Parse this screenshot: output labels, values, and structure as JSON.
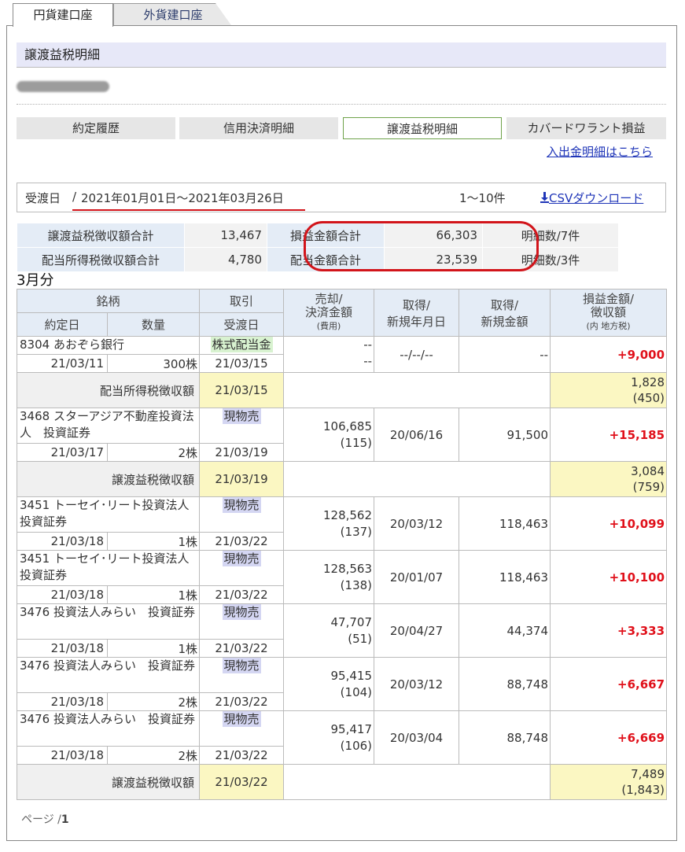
{
  "tabs": {
    "active": "円貨建口座",
    "inactive": "外貨建口座"
  },
  "title": "譲渡益税明細",
  "subtabs": [
    "約定履歴",
    "信用決済明細",
    "譲渡益税明細",
    "カバードワラント損益"
  ],
  "deposit_link": "入出金明細はこちら",
  "date_label": "受渡日",
  "date_slash": "/",
  "date_range": "2021年01月01日～2021年03月26日",
  "count": "1～10件",
  "csv_label": "CSVダウンロード",
  "summary": {
    "row1": {
      "l1": "譲渡益税徴収額合計",
      "v1": "13,467",
      "l2": "損益金額合計",
      "v2": "66,303",
      "n": "明細数/7件"
    },
    "row2": {
      "l1": "配当所得税徴収額合計",
      "v1": "4,780",
      "l2": "配当金額合計",
      "v2": "23,539",
      "n": "明細数/3件"
    }
  },
  "month": "3月分",
  "headers": {
    "brand": "銘柄",
    "trade": "取引",
    "contract_date": "約定日",
    "qty": "数量",
    "delivery": "受渡日",
    "sale1": "売却/",
    "sale2": "決済金額",
    "sale3": "(費用)",
    "acq1": "取得/",
    "acq2": "新規年月日",
    "acqamt1": "取得/",
    "acqamt2": "新規金額",
    "pl1": "損益金額/",
    "pl2": "徴収額",
    "pl3": "(内 地方税)"
  },
  "rows": [
    {
      "name": "8304 あおぞら銀行",
      "trade": "株式配当金",
      "trade_type": "div",
      "date": "21/03/11",
      "qty": "300株",
      "deliv": "21/03/15",
      "sale": "--",
      "cost": "--",
      "acq_date": "--/--/--",
      "acq_amt": "--",
      "pl": "+9,000"
    },
    {
      "tax": true,
      "label": "配当所得税徴収額",
      "deliv": "21/03/15",
      "amt": "1,828",
      "local": "(450)"
    },
    {
      "name": "3468 スターアジア不動産投資法人　投資証券",
      "trade": "現物売",
      "trade_type": "sell",
      "date": "21/03/17",
      "qty": "2株",
      "deliv": "21/03/19",
      "sale": "106,685",
      "cost": "(115)",
      "acq_date": "20/06/16",
      "acq_amt": "91,500",
      "pl": "+15,185"
    },
    {
      "tax": true,
      "label": "譲渡益税徴収額",
      "deliv": "21/03/19",
      "amt": "3,084",
      "local": "(759)"
    },
    {
      "name": "3451 トーセイ･リート投資法人　投資証券",
      "trade": "現物売",
      "trade_type": "sell",
      "date": "21/03/18",
      "qty": "1株",
      "deliv": "21/03/22",
      "sale": "128,562",
      "cost": "(137)",
      "acq_date": "20/03/12",
      "acq_amt": "118,463",
      "pl": "+10,099"
    },
    {
      "name": "3451 トーセイ･リート投資法人　投資証券",
      "trade": "現物売",
      "trade_type": "sell",
      "date": "21/03/18",
      "qty": "1株",
      "deliv": "21/03/22",
      "sale": "128,563",
      "cost": "(138)",
      "acq_date": "20/01/07",
      "acq_amt": "118,463",
      "pl": "+10,100"
    },
    {
      "name": "3476 投資法人みらい　投資証券",
      "trade": "現物売",
      "trade_type": "sell",
      "date": "21/03/18",
      "qty": "1株",
      "deliv": "21/03/22",
      "sale": "47,707",
      "cost": "(51)",
      "acq_date": "20/04/27",
      "acq_amt": "44,374",
      "pl": "+3,333"
    },
    {
      "name": "3476 投資法人みらい　投資証券",
      "trade": "現物売",
      "trade_type": "sell",
      "date": "21/03/18",
      "qty": "2株",
      "deliv": "21/03/22",
      "sale": "95,415",
      "cost": "(104)",
      "acq_date": "20/03/12",
      "acq_amt": "88,748",
      "pl": "+6,667"
    },
    {
      "name": "3476 投資法人みらい　投資証券",
      "trade": "現物売",
      "trade_type": "sell",
      "date": "21/03/18",
      "qty": "2株",
      "deliv": "21/03/22",
      "sale": "95,417",
      "cost": "(106)",
      "acq_date": "20/03/04",
      "acq_amt": "88,748",
      "pl": "+6,669"
    },
    {
      "tax": true,
      "label": "譲渡益税徴収額",
      "deliv": "21/03/22",
      "amt": "7,489",
      "local": "(1,843)"
    }
  ],
  "pager": {
    "text": "ページ /",
    "page": "1"
  },
  "colors": {
    "accent_red": "#d2141a",
    "header_bg": "#e4ecf6",
    "tax_yellow": "#fbf7c2"
  }
}
